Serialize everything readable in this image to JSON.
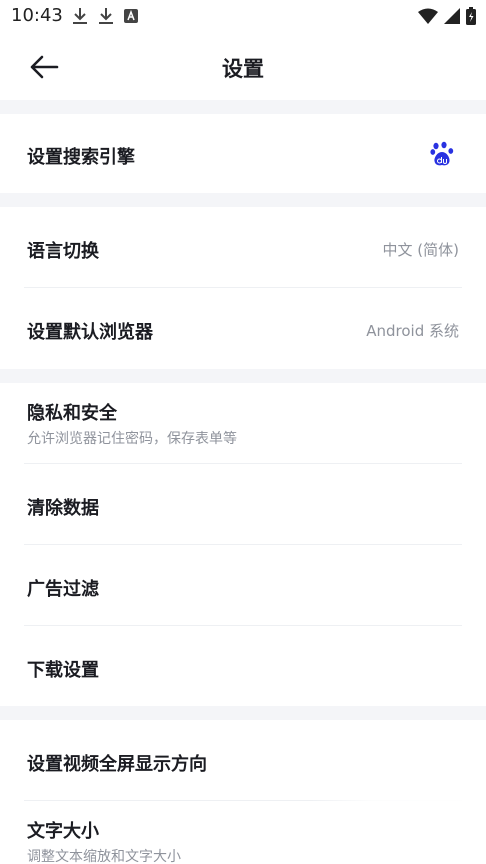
{
  "status_bar": {
    "time": "10:43",
    "left_icons": [
      "download-icon",
      "download-icon",
      "a-box-icon"
    ],
    "right_icons": [
      "wifi-icon",
      "signal-icon",
      "battery-icon"
    ]
  },
  "header": {
    "back_icon": "arrow-left-icon",
    "title": "设置"
  },
  "sections": {
    "search": {
      "label": "设置搜索引擎",
      "engine_icon": "baidu-paw-icon"
    },
    "language": {
      "label": "语言切换",
      "value": "中文 (简体)"
    },
    "default_browser": {
      "label": "设置默认浏览器",
      "value": "Android 系统"
    },
    "privacy": {
      "label": "隐私和安全",
      "sub": "允许浏览器记住密码，保存表单等"
    },
    "clear_data": {
      "label": "清除数据"
    },
    "ad_filter": {
      "label": "广告过滤"
    },
    "download": {
      "label": "下载设置"
    },
    "video_orientation": {
      "label": "设置视频全屏显示方向"
    },
    "text_size": {
      "label": "文字大小",
      "sub": "调整文本缩放和文字大小"
    }
  },
  "colors": {
    "background": "#f4f5f8",
    "card": "#ffffff",
    "text_primary": "#1b1c22",
    "text_secondary": "#8f939c",
    "baidu_blue": "#2932e1"
  }
}
